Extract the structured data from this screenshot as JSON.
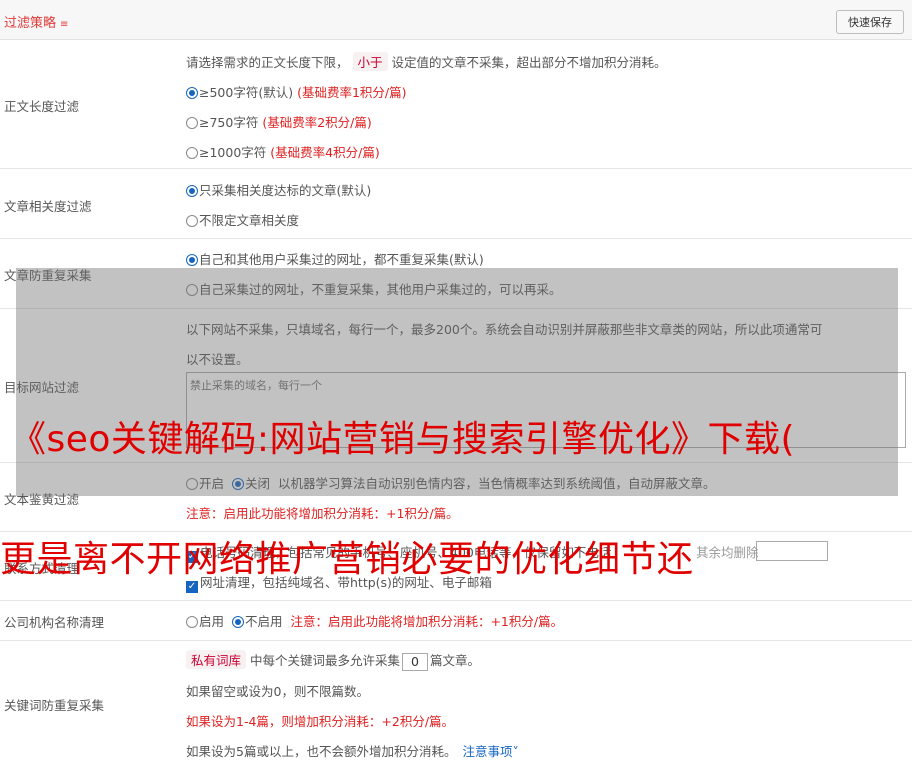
{
  "header": {
    "title": "过滤策略",
    "chevron_icon": "double-chevron-down-icon",
    "save_label": "快速保存"
  },
  "length_filter": {
    "label": "正文长度过滤",
    "desc_pre": "请选择需求的正文长度下限，",
    "desc_pill": "小于",
    "desc_post": "设定值的文章不采集，超出部分不增加积分消耗。",
    "options": [
      {
        "text": "≥500字符(默认)",
        "note": "(基础费率1积分/篇)",
        "checked": true
      },
      {
        "text": "≥750字符",
        "note": "(基础费率2积分/篇)",
        "checked": false
      },
      {
        "text": "≥1000字符",
        "note": "(基础费率4积分/篇)",
        "checked": false
      }
    ]
  },
  "relevance_filter": {
    "label": "文章相关度过滤",
    "options": [
      {
        "text": "只采集相关度达标的文章(默认)",
        "checked": true
      },
      {
        "text": "不限定文章相关度",
        "checked": false
      }
    ]
  },
  "dedupe": {
    "label": "文章防重复采集",
    "options": [
      {
        "text": "自己和其他用户采集过的网址，都不重复采集(默认)",
        "checked": true
      },
      {
        "text": "自己采集过的网址，不重复采集，其他用户采集过的，可以再采。",
        "checked": false
      }
    ]
  },
  "target_site": {
    "label": "目标网站过滤",
    "desc1": "以下网站不采集，只填域名，每行一个，最多200个。系统会自动识别并屏蔽那些非文章类的网站，所以此项通常可",
    "desc2": "以不设置。",
    "placeholder": "禁止采集的域名，每行一个"
  },
  "porn_filter": {
    "label": "文本鉴黄过滤",
    "opt_on": "开启",
    "opt_off": "关闭",
    "desc": "以机器学习算法自动识别色情内容，当色情概率达到系统阈值，自动屏蔽文章。",
    "warn": "注意：启用此功能将增加积分消耗：+1积分/篇。"
  },
  "contact_clean": {
    "label": "联系方式清理",
    "line1": "电话号码清理，包括常见的手机号、座机号、400电话等，仅保留如下电话",
    "line1_trail": "其余均删除",
    "line2": "网址清理，包括纯域名、带http(s)的网址、电子邮箱"
  },
  "company_clean": {
    "label": "公司机构名称清理",
    "opt_on": "启用",
    "opt_off": "不启用",
    "warn": "注意：启用此功能将增加积分消耗：+1积分/篇。"
  },
  "keyword_dedupe": {
    "label": "关键词防重复采集",
    "pill": "私有词库",
    "line1_pre": "中每个关键词最多允许采集",
    "value": "0",
    "line1_post": "篇文章。",
    "line2": "如果留空或设为0，则不限篇数。",
    "line3": "如果设为1-4篇，则增加积分消耗：+2积分/篇。",
    "line4": "如果设为5篇或以上，也不会额外增加积分消耗。",
    "link": "注意事项"
  },
  "overlay_text": {
    "line1": "《seo关键解码:网站营销与搜索引擎优化》下载(",
    "line2": "更是离不开网络推广营销必要的优化细节还"
  }
}
